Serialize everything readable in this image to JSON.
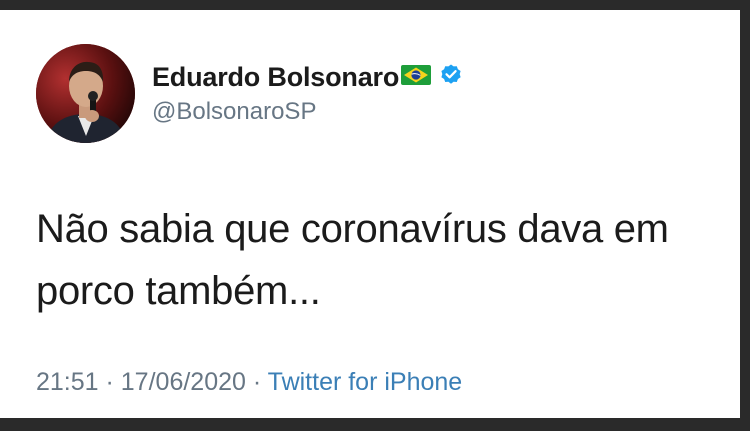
{
  "tweet": {
    "author_name": "Eduardo Bolsonaro",
    "handle": "@BolsonaroSP",
    "text_line1": "Não sabia que coronavírus dava em",
    "text_line2": "porco também...",
    "time": "21:51",
    "separator1": " · ",
    "date": "17/06/2020",
    "separator2": " · ",
    "source": "Twitter for iPhone"
  },
  "icons": {
    "flag": "brazil-flag-icon",
    "verified": "verified-badge-icon"
  },
  "colors": {
    "text": "#1b1b1b",
    "secondary": "#677684",
    "link": "#3b7fb6",
    "verified": "#1da1f2",
    "background_frame": "#2a2a2a"
  }
}
